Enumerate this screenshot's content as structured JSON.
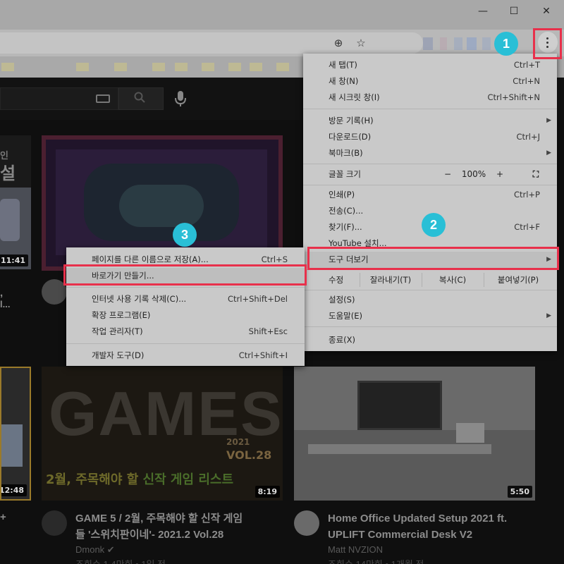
{
  "window": {
    "minimize": "—",
    "maximize": "☐",
    "close": "✕"
  },
  "toolbar": {
    "add_icon": "plus-circle-icon",
    "star_icon": "star-icon",
    "menu_icon": "three-dot-menu-icon"
  },
  "menu": {
    "items": [
      {
        "label": "새 탭(T)",
        "shortcut": "Ctrl+T"
      },
      {
        "label": "새 창(N)",
        "shortcut": "Ctrl+N"
      },
      {
        "label": "새 시크릿 창(I)",
        "shortcut": "Ctrl+Shift+N"
      },
      {
        "label": "방문 기록(H)",
        "shortcut": ""
      },
      {
        "label": "다운로드(D)",
        "shortcut": "Ctrl+J"
      },
      {
        "label": "북마크(B)",
        "shortcut": ""
      },
      {
        "label": "인쇄(P)",
        "shortcut": "Ctrl+P"
      },
      {
        "label": "전송(C)...",
        "shortcut": ""
      },
      {
        "label": "찾기(F)...",
        "shortcut": "Ctrl+F"
      },
      {
        "label": "YouTube 설치...",
        "shortcut": ""
      },
      {
        "label": "도구 더보기",
        "shortcut": ""
      },
      {
        "label": "설정(S)",
        "shortcut": ""
      },
      {
        "label": "도움말(E)",
        "shortcut": ""
      },
      {
        "label": "종료(X)",
        "shortcut": ""
      }
    ],
    "zoom": {
      "label": "글꼴 크기",
      "minus": "−",
      "value": "100%",
      "plus": "+"
    },
    "edit": {
      "label": "수정",
      "cut": "잘라내기(T)",
      "copy": "복사(C)",
      "paste": "붙여넣기(P)"
    }
  },
  "submenu": {
    "items": [
      {
        "label": "페이지를 다른 이름으로 저장(A)...",
        "shortcut": "Ctrl+S"
      },
      {
        "label": "바로가기 만들기...",
        "shortcut": ""
      },
      {
        "label": "인터넷 사용 기록 삭제(C)...",
        "shortcut": "Ctrl+Shift+Del"
      },
      {
        "label": "확장 프로그램(E)",
        "shortcut": ""
      },
      {
        "label": "작업 관리자(T)",
        "shortcut": "Shift+Esc"
      },
      {
        "label": "개발자 도구(D)",
        "shortcut": "Ctrl+Shift+I"
      }
    ]
  },
  "badges": [
    "1",
    "2",
    "3"
  ],
  "colors": {
    "highlight": "#e8304b",
    "badge": "#29bfd6"
  },
  "videos": [
    {
      "duration": "11:41"
    },
    {
      "duration": "12:48"
    },
    {
      "duration": "8:19",
      "title_line1": "GAME 5 / 2월, 주목해야 할 신작 게임",
      "title_line2": "들 '스위치판이네'- 2021.2 Vol.28",
      "channel": "Dmonk ✔",
      "meta": "조회수 1.4만회 • 1일 전"
    },
    {
      "duration": "5:50",
      "title_line1": "Home Office Updated Setup 2021 ft.",
      "title_line2": "UPLIFT Commercial Desk V2",
      "channel": "Matt NVZION",
      "meta": "조회수 14만회 • 1개월 전"
    }
  ],
  "thumb_text": {
    "game_big": "GAMES",
    "game_year": "2021",
    "game_vol": "VOL.28",
    "game_caption_a": "2월, 주목해야 할",
    "game_caption_b": "신작 게임 리스트",
    "left_top_a": "인",
    "left_top_b": "설",
    "left_edge_a": ",",
    "left_edge_b": "l...",
    "left_plus": "+"
  }
}
